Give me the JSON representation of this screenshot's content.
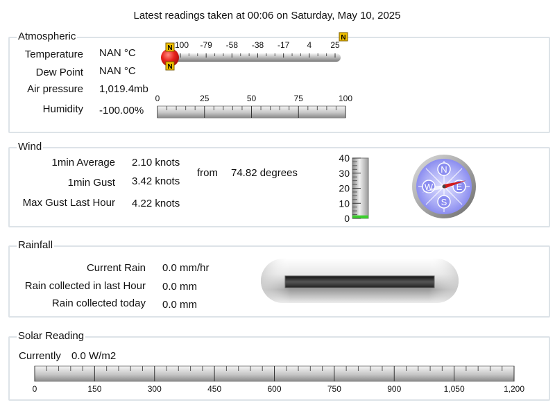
{
  "header": {
    "title": "Latest readings taken at  00:06 on Saturday, May 10, 2025"
  },
  "atmospheric": {
    "legend": "Atmospheric",
    "temperature": {
      "label": "Temperature",
      "value": "NAN °C"
    },
    "dew_point": {
      "label": "Dew Point",
      "value": "NAN °C"
    },
    "pressure": {
      "label": "Air pressure",
      "value": "1,019.4mb"
    },
    "humidity": {
      "label": "Humidity",
      "value": "-100.00%"
    },
    "temp_scale": {
      "ticks": [
        "-100",
        "-79",
        "-58",
        "-38",
        "-17",
        "4",
        "25"
      ]
    },
    "humidity_scale": {
      "ticks": [
        "0",
        "25",
        "50",
        "75",
        "100"
      ],
      "value": -100
    }
  },
  "wind": {
    "legend": "Wind",
    "avg": {
      "label": "1min Average",
      "value": "2.10 knots"
    },
    "gust": {
      "label": "1min Gust",
      "value": "3.42 knots"
    },
    "max_gust": {
      "label": "Max Gust Last Hour",
      "value": "4.22 knots"
    },
    "from_label": "from",
    "direction": "74.82 degrees",
    "direction_deg": 74.82,
    "speed_scale": {
      "ticks": [
        "40",
        "30",
        "20",
        "10",
        "0"
      ],
      "fill_fraction": 0.05
    },
    "compass": {
      "n": "N",
      "e": "E",
      "s": "S",
      "w": "W"
    }
  },
  "rainfall": {
    "legend": "Rainfall",
    "current": {
      "label": "Current Rain",
      "value": "0.0 mm/hr"
    },
    "last_hour": {
      "label": "Rain collected in last Hour",
      "value": "0.0 mm"
    },
    "today": {
      "label": "Rain collected today",
      "value": "0.0 mm"
    }
  },
  "solar": {
    "legend": "Solar Reading",
    "current_label": "Currently",
    "current_value": "0.0 W/m2",
    "scale": {
      "ticks": [
        "0",
        "150",
        "300",
        "450",
        "600",
        "750",
        "900",
        "1,050",
        "1,200"
      ]
    },
    "fill_fraction": 0
  },
  "colors": {
    "panel_border": "#dde3e8",
    "alert_icon": "#f2c200",
    "bulb": "#e8231c",
    "wind_bar": "#3ccf2e"
  }
}
